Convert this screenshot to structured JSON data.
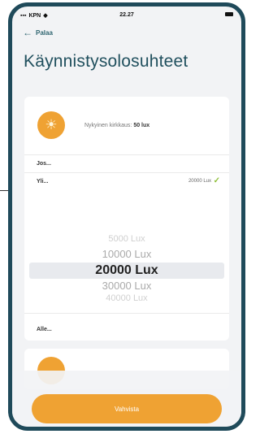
{
  "status_bar": {
    "carrier": "KPN",
    "time": "22.27"
  },
  "nav": {
    "back_label": "Palaa"
  },
  "page": {
    "title": "Käynnistysolosuhteet"
  },
  "current_light": {
    "label": "Nykyinen kirkkaus:",
    "value": "50 lux"
  },
  "rows": {
    "first_label": "Jos...",
    "second_label": "Yli...",
    "second_value": "20000 Lux",
    "third_label": "Alle..."
  },
  "picker": {
    "items": [
      "5000 Lux",
      "10000 Lux",
      "20000 Lux",
      "30000 Lux",
      "40000 Lux"
    ],
    "selected": "20000 Lux"
  },
  "actions": {
    "confirm_label": "Vahvista"
  },
  "colors": {
    "accent": "#efa233",
    "frame": "#1f4a5a",
    "title": "#21505e",
    "check": "#8fbf3a"
  }
}
